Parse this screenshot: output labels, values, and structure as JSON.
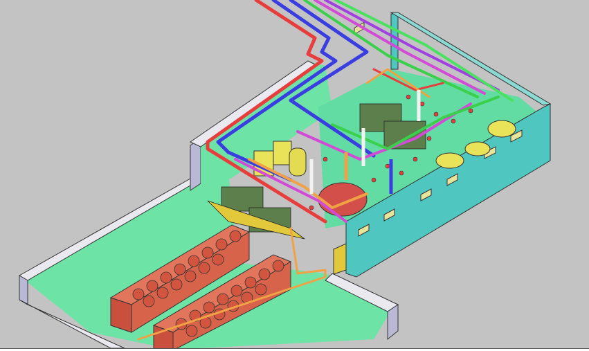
{
  "scene": {
    "subject": "isometric-3d-cad-model",
    "icons": [
      "cooling-tower-icon",
      "pump-skid-icon",
      "pipe-run-icon",
      "storage-tank-icon"
    ]
  },
  "colors": {
    "background": "#c3c3c3",
    "floor": "#6de3a6",
    "wall_top": "#e9e9ef",
    "wall_side": "#b9b9d6",
    "building_wall": "#4fc6c0",
    "building_floor": "#63dca4",
    "cooling_tower": "#d7634a",
    "pipe_red": "#e83d3d",
    "pipe_blue": "#3a3de0",
    "pipe_magenta": "#d24bd6",
    "pipe_green": "#3ad04b",
    "pipe_orange": "#f0a244",
    "tank_yellow": "#e9e35a",
    "vessel_red": "#d24f4a"
  }
}
